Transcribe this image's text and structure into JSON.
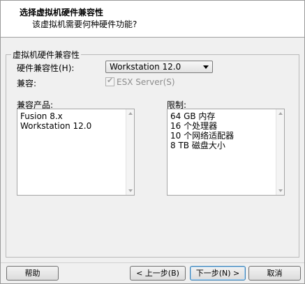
{
  "header": {
    "title": "选择虚拟机硬件兼容性",
    "subtitle": "该虚拟机需要何种硬件功能?"
  },
  "group": {
    "label": "虚拟机硬件兼容性",
    "compat_label": "硬件兼容性(H):",
    "compat_value": "Workstation 12.0",
    "compatible_label": "兼容:",
    "esx_label": "ESX Server(S)",
    "esx_checked": true,
    "esx_enabled": false
  },
  "products": {
    "label": "兼容产品:",
    "items": [
      "Fusion 8.x",
      "Workstation 12.0"
    ]
  },
  "limits": {
    "label": "限制:",
    "items": [
      "64 GB 内存",
      "16 个处理器",
      "10 个网络适配器",
      "8 TB 磁盘大小"
    ]
  },
  "footer": {
    "help": "帮助",
    "back": "< 上一步(B)",
    "next": "下一步(N) >",
    "cancel": "取消"
  }
}
